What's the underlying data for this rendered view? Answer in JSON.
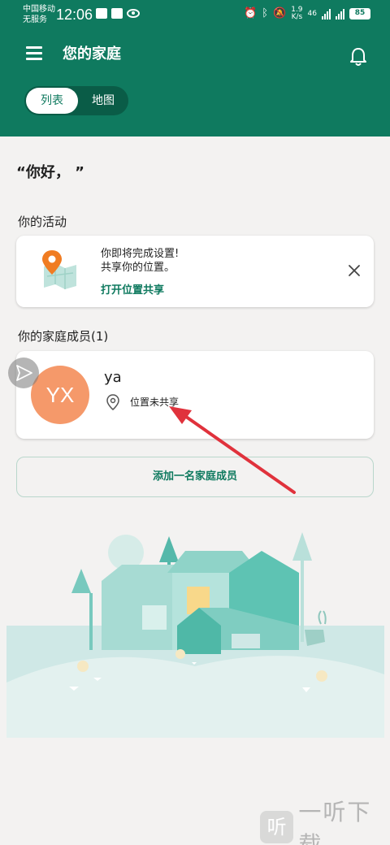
{
  "status_bar": {
    "carrier_line1": "中国移动",
    "carrier_line2": "无服务",
    "time": "12:06",
    "speed_value": "1.9",
    "speed_unit": "K/s",
    "network": "46",
    "battery": "85"
  },
  "header": {
    "title": "您的家庭",
    "view_tabs": [
      {
        "label": "列表",
        "active": true
      },
      {
        "label": "地图",
        "active": false
      }
    ]
  },
  "greeting": "“你好，      ”",
  "activity": {
    "section_title": "你的活动",
    "message_line1": "你即将完成设置!",
    "message_line2": "共享你的位置。",
    "action_label": "打开位置共享"
  },
  "family": {
    "section_title": "你的家庭成员(1)",
    "members": [
      {
        "initials": "YX",
        "name": "ya",
        "location_status": "位置未共享",
        "avatar_color": "#f5996a"
      }
    ],
    "add_member_label": "添加一名家庭成员"
  },
  "watermark": {
    "logo_glyph": "听",
    "text": "一听下载"
  },
  "colors": {
    "brand": "#0f7a5f",
    "annotation_arrow": "#e0323c"
  }
}
